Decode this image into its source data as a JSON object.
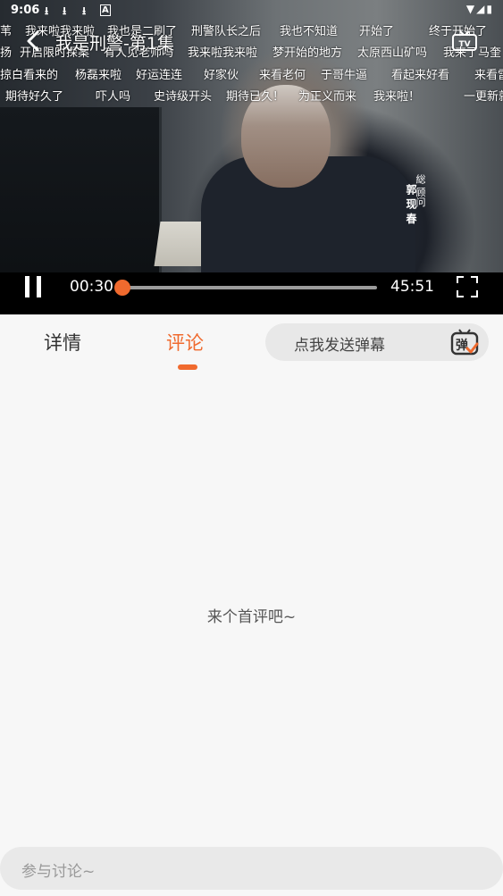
{
  "status_bar": {
    "time": "9:06",
    "download_icon": "download-icon",
    "a_icon": "A"
  },
  "player": {
    "title": "我是刑警-第1集",
    "vertical_caption": "総 顾问",
    "vertical_name": "郭 现 春",
    "current_time": "00:30",
    "total_time": "45:51",
    "progress_fraction": 0.011
  },
  "danmaku": [
    [
      "苇",
      "我来啦我来啦",
      "我也是二刷了",
      "刑警队长之后",
      "我也不知道",
      "开始了",
      "终于开始了"
    ],
    [
      "扬",
      "开启限时探案",
      "有人见老师吗",
      "我来啦我来啦",
      "梦开始的地方",
      "太原西山矿吗",
      "我来了马奎"
    ],
    [
      "掠白看来的",
      "杨磊来啦",
      "好运连连",
      "好家伙",
      "来看老何",
      "于哥牛逼",
      "看起来好看",
      "来看雷"
    ],
    [
      "期待好久了",
      "吓人吗",
      "史诗级开头",
      "期待已久！",
      "为正义而来",
      "我来啦！",
      "一更新就"
    ]
  ],
  "tabs": {
    "details": "详情",
    "comments": "评论"
  },
  "danmaku_input": {
    "placeholder": "点我发送弹幕",
    "icon_label": "弹"
  },
  "comments": {
    "empty_text": "来个首评吧~",
    "input_placeholder": "参与讨论~"
  },
  "colors": {
    "accent": "#f06a2e"
  }
}
